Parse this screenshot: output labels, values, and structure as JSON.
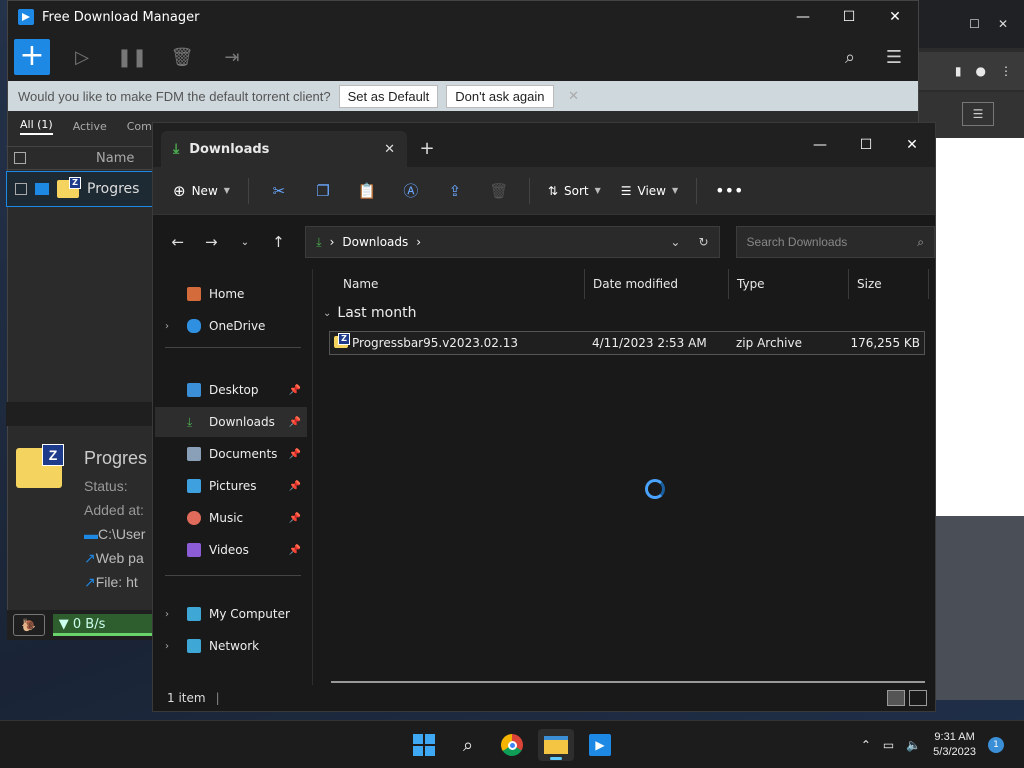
{
  "fdm": {
    "title": "Free Download Manager",
    "banner_text": "Would you like to make FDM the default torrent client?",
    "set_default_label": "Set as Default",
    "dont_ask_label": "Don't ask again",
    "tabs": [
      "All (1)",
      "Active",
      "Comp"
    ],
    "list_header_name": "Name",
    "row_name": "Progres",
    "details": {
      "name": "Progres",
      "status": "Status:",
      "added": "Added at:",
      "path": "C:\\User",
      "web": "Web pa",
      "file": "File: ht"
    },
    "speed": "▼ 0 B/s"
  },
  "explorer": {
    "tab_title": "Downloads",
    "new_label": "New",
    "sort_label": "Sort",
    "view_label": "View",
    "address_segment": "Downloads",
    "search_placeholder": "Search Downloads",
    "sidebar": [
      {
        "label": "Home",
        "color": "#d36b3b"
      },
      {
        "label": "OneDrive",
        "color": "#2f8fe0"
      },
      {
        "label": "Desktop",
        "color": "#3b8fd6"
      },
      {
        "label": "Downloads",
        "color": "#4caf50"
      },
      {
        "label": "Documents",
        "color": "#8aa0b8"
      },
      {
        "label": "Pictures",
        "color": "#3fa0e0"
      },
      {
        "label": "Music",
        "color": "#e06b5b"
      },
      {
        "label": "Videos",
        "color": "#8b5cd6"
      },
      {
        "label": "My Computer",
        "color": "#3fa7d6"
      },
      {
        "label": "Network",
        "color": "#3fa7d6"
      }
    ],
    "columns": [
      "Name",
      "Date modified",
      "Type",
      "Size"
    ],
    "group_label": "Last month",
    "file": {
      "name": "Progressbar95.v2023.02.13",
      "date": "4/11/2023 2:53 AM",
      "type": "zip Archive",
      "size": "176,255 KB"
    },
    "status_count": "1 item"
  },
  "taskbar": {
    "time": "9:31 AM",
    "date": "5/3/2023",
    "notifications": "1"
  }
}
